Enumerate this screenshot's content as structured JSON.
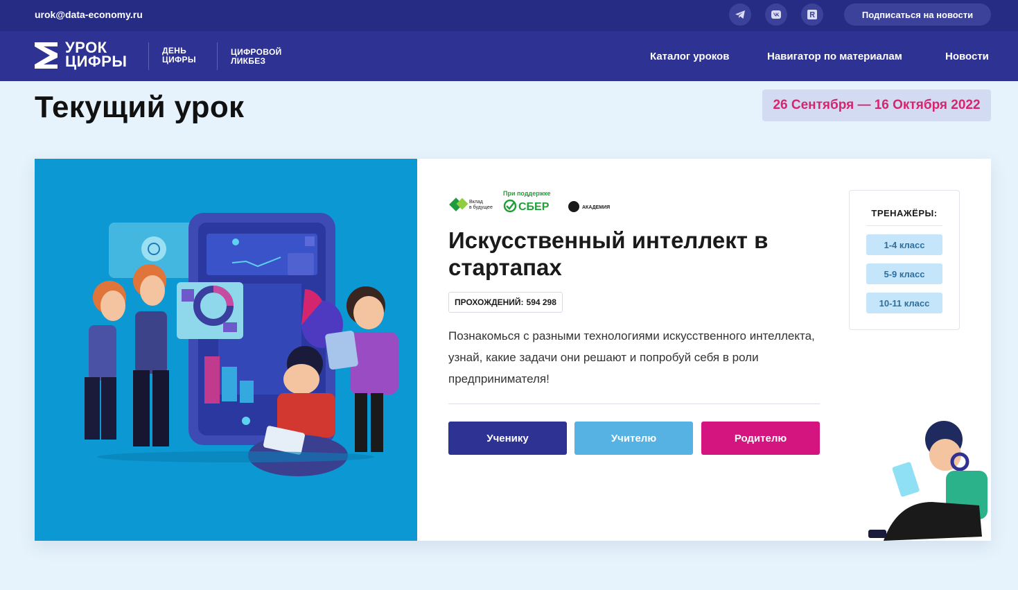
{
  "topbar": {
    "email": "urok@data-economy.ru",
    "social_icons": [
      "telegram-icon",
      "vk-icon",
      "rutube-icon"
    ],
    "subscribe_label": "Подписаться на новости"
  },
  "nav": {
    "logo": {
      "line1": "УРОК",
      "line2": "ЦИФРЫ"
    },
    "sub_logo_1": {
      "line1": "ДЕНЬ",
      "line2": "ЦИФРЫ"
    },
    "sub_logo_2": {
      "line1": "ЦИФРОВОЙ",
      "line2": "ЛИКБЕЗ"
    },
    "links": [
      "Каталог уроков",
      "Навигатор по материалам",
      "Новости"
    ]
  },
  "page": {
    "title": "Текущий урок",
    "dates": "26 Сентября — 16 Октября 2022"
  },
  "lesson": {
    "partners": {
      "vklad_line1": "Вклад",
      "vklad_line2": "в будущее",
      "support_label": "При поддержке",
      "sber": "СБЕР",
      "academy": "АКАДЕМИЯ"
    },
    "title": "Искусственный интеллект в стартапах",
    "passes_label": "ПРОХОЖДЕНИЙ:",
    "passes_value": "594 298",
    "description": "Познакомься с разными технологиями искусственного интеллекта, узнай, какие задачи они решают и попробуй себя в роли предпринимателя!",
    "buttons": [
      {
        "label": "Ученику",
        "color": "#2e3293"
      },
      {
        "label": "Учителю",
        "color": "#56b2e3"
      },
      {
        "label": "Родителю",
        "color": "#d5157f"
      }
    ]
  },
  "trainers": {
    "title": "ТРЕНАЖЁРЫ:",
    "items": [
      "1-4 класс",
      "5-9 класс",
      "10-11 класс"
    ]
  },
  "colors": {
    "topbar": "#262b83",
    "nav": "#2e3293",
    "accent_pink": "#d6256f",
    "illustration_bg": "#0c98d2",
    "page_bg": "#e6f3fc"
  }
}
